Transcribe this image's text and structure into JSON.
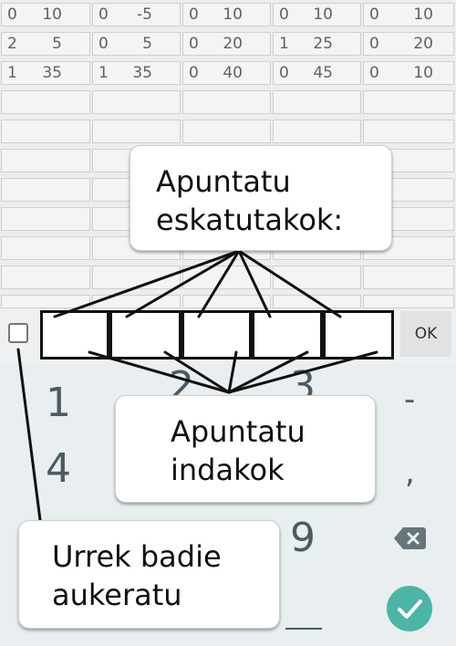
{
  "grid_rows": [
    [
      [
        "0",
        "10"
      ],
      [
        "0",
        "-5"
      ],
      [
        "0",
        "10"
      ],
      [
        "0",
        "10"
      ],
      [
        "0",
        "10"
      ]
    ],
    [
      [
        "2",
        "5"
      ],
      [
        "0",
        "5"
      ],
      [
        "0",
        "20"
      ],
      [
        "1",
        "25"
      ],
      [
        "0",
        "20"
      ]
    ],
    [
      [
        "1",
        "35"
      ],
      [
        "1",
        "35"
      ],
      [
        "0",
        "40"
      ],
      [
        "0",
        "45"
      ],
      [
        "0",
        "10"
      ]
    ]
  ],
  "input": {
    "ok_label": "OK"
  },
  "keyboard": {
    "key_1": "1",
    "key_2": "2",
    "key_3": "3",
    "key_4": "4",
    "key_9": "9",
    "key_minus": "-",
    "key_comma": ","
  },
  "callouts": {
    "top": [
      "Apuntatu",
      "eskatutakok:"
    ],
    "middle": [
      "Apuntatu",
      "indakok"
    ],
    "bottom": [
      "Urrek badie",
      "aukeratu"
    ]
  },
  "icons": {
    "backspace": "backspace-icon",
    "confirm": "check-icon",
    "checkbox": "checkbox-icon"
  },
  "colors": {
    "confirm_button": "#4cb5a7",
    "keyboard_bg": "#e9eef0",
    "key_text": "#4b5b63"
  }
}
